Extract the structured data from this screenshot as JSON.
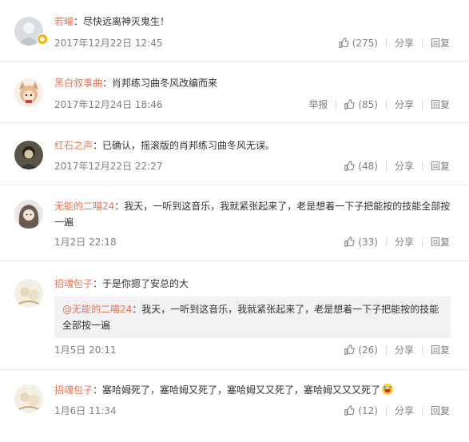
{
  "comments": [
    {
      "user": "若曜",
      "sep": "：",
      "text": "尽快远离神灭鬼生！",
      "time": "2017年12月22日 12:45",
      "report": "",
      "likes": "(275)",
      "share": "分享",
      "reply": "回复"
    },
    {
      "user": "黑白叙事曲",
      "sep": "：",
      "text": "肖邦练习曲冬风改编而来",
      "time": "2017年12月24日 18:46",
      "report": "举报",
      "likes": "(85)",
      "share": "分享",
      "reply": "回复"
    },
    {
      "user": "红石之声",
      "sep": "：",
      "text": "已确认，摇滚版的肖邦练习曲冬风无误。",
      "time": "2017年12月22日 22:27",
      "report": "",
      "likes": "(48)",
      "share": "分享",
      "reply": "回复"
    },
    {
      "user": "无能的二喵24",
      "sep": "：",
      "text": "我天，一听到这音乐，我就紧张起来了，老是想着一下子把能按的技能全部按一遍",
      "time": "1月2日 22:18",
      "report": "",
      "likes": "(33)",
      "share": "分享",
      "reply": "回复"
    },
    {
      "user": "招魂包子",
      "sep": "：",
      "text": "于是你摁了安总的大",
      "quote_user": "@无能的二喵24",
      "quote_sep": "：",
      "quote_text": "我天，一听到这音乐，我就紧张起来了，老是想着一下子把能按的技能全部按一遍",
      "time": "1月5日 20:11",
      "report": "",
      "likes": "(26)",
      "share": "分享",
      "reply": "回复"
    },
    {
      "user": "招魂包子",
      "sep": "：",
      "text": "塞哈姆死了，塞哈姆又死了，塞哈姆又又死了，塞哈姆又又又死了",
      "time": "1月6日 11:34",
      "report": "",
      "likes": "(12)",
      "share": "分享",
      "reply": "回复"
    }
  ],
  "icons": {
    "like": "thumbs-up-icon",
    "badge": "vip-badge-icon",
    "emoji": "laugh-cry-emoji-icon"
  },
  "colors": {
    "username": "#eb7350",
    "meta": "#808080",
    "text": "#333333",
    "quote_bg": "#f2f2f5",
    "divider": "#ececec"
  }
}
